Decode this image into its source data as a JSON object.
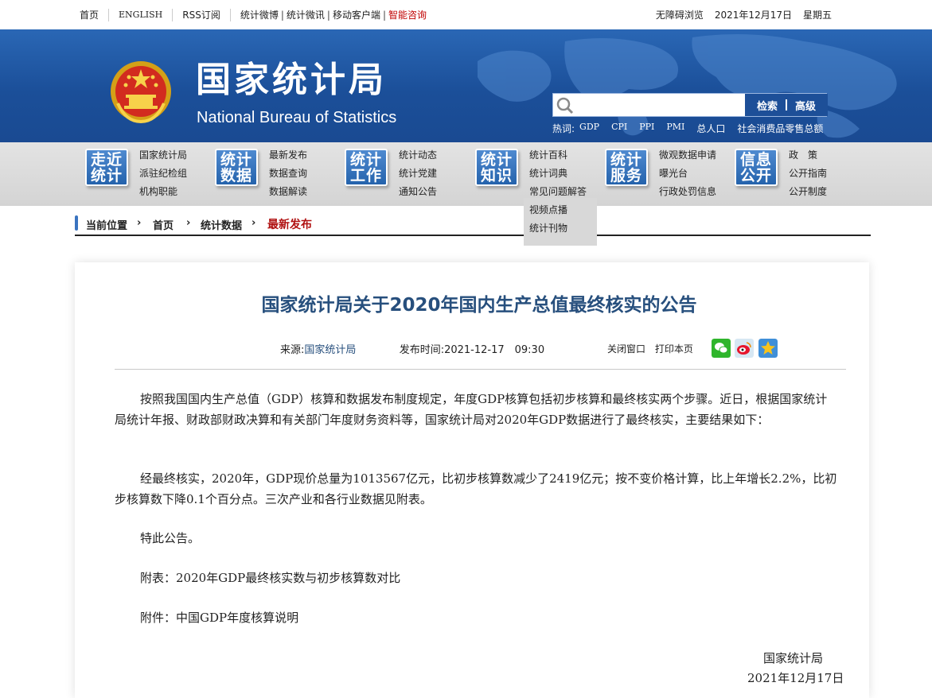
{
  "topbar": {
    "home": "首页",
    "english": "ENGLISH",
    "rss": "RSS订阅",
    "weibo": "统计微博",
    "wechat": "统计微讯",
    "mobile": "移动客户端",
    "smart": "智能咨询",
    "accessible": "无障碍浏览",
    "date": "2021年12月17日",
    "weekday": "星期五"
  },
  "header": {
    "title_cn": "国家统计局",
    "title_en": "National Bureau of Statistics"
  },
  "search": {
    "placeholder": "",
    "search_btn": "检索",
    "advanced_btn": "高级",
    "hot_label": "热词:",
    "hot_words": [
      "GDP",
      "CPI",
      "PPI",
      "PMI",
      "总人口",
      "社会消费品零售总额"
    ]
  },
  "nav": [
    {
      "tile": [
        "走近",
        "统计"
      ],
      "links": [
        "国家统计局",
        "派驻纪检组",
        "机构职能"
      ]
    },
    {
      "tile": [
        "统计",
        "数据"
      ],
      "links": [
        "最新发布",
        "数据查询",
        "数据解读"
      ]
    },
    {
      "tile": [
        "统计",
        "工作"
      ],
      "links": [
        "统计动态",
        "统计党建",
        "通知公告"
      ]
    },
    {
      "tile": [
        "统计",
        "知识"
      ],
      "links": [
        "统计百科",
        "统计词典",
        "常见问题解答"
      ]
    },
    {
      "tile": [
        "统计",
        "服务"
      ],
      "links": [
        "微观数据申请",
        "曝光台",
        "行政处罚信息"
      ]
    },
    {
      "tile": [
        "信息",
        "公开"
      ],
      "links": [
        "政　策",
        "公开指南",
        "公开制度"
      ]
    }
  ],
  "dropdown": [
    "视频点播",
    "统计刊物"
  ],
  "breadcrumb": {
    "label": "当前位置",
    "items": [
      "首页",
      "统计数据",
      "最新发布"
    ]
  },
  "article": {
    "title": "国家统计局关于2020年国内生产总值最终核实的公告",
    "source_label": "来源:",
    "source": "国家统计局",
    "time_label": "发布时间:",
    "time": "2021-12-17　09:30",
    "close_window": "关闭窗口",
    "print_page": "打印本页",
    "paragraphs": [
      "按照我国国内生产总值（GDP）核算和数据发布制度规定，年度GDP核算包括初步核算和最终核实两个步骤。近日，根据国家统计局统计年报、财政部财政决算和有关部门年度财务资料等，国家统计局对2020年GDP数据进行了最终核实，主要结果如下：",
      "经最终核实，2020年，GDP现价总量为1013567亿元，比初步核算数减少了2419亿元；按不变价格计算，比上年增长2.2%，比初步核算数下降0.1个百分点。三次产业和各行业数据见附表。",
      "特此公告。",
      "附表：2020年GDP最终核实数与初步核算数对比",
      "附件：中国GDP年度核算说明"
    ],
    "signature": "国家统计局",
    "sign_date": "2021年12月17日"
  },
  "colors": {
    "banner": "#1b4f99",
    "accent_red": "#c00000",
    "title_blue": "#274f7d"
  }
}
